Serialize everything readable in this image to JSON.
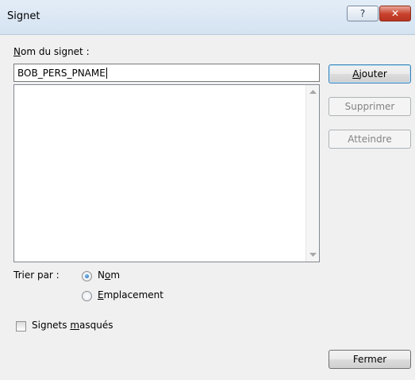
{
  "window": {
    "title": "Signet",
    "help_label": "?",
    "close_label": "✕"
  },
  "name_field": {
    "label_u": "N",
    "label_rest": "om du signet :",
    "value": "BOB_PERS_PNAME"
  },
  "bookmarks_list": [],
  "buttons": {
    "add_u": "A",
    "add_rest": "jouter",
    "delete": "Supprimer",
    "goto": "Atteindre",
    "close": "Fermer"
  },
  "sort": {
    "label": "Trier par :",
    "options": [
      {
        "pre": "N",
        "u": "o",
        "post": "m",
        "checked": true
      },
      {
        "pre": "",
        "u": "E",
        "post": "mplacement",
        "checked": false
      }
    ]
  },
  "hidden_bookmarks": {
    "pre": "Signets ",
    "u": "m",
    "post": "asqués",
    "checked": false
  }
}
